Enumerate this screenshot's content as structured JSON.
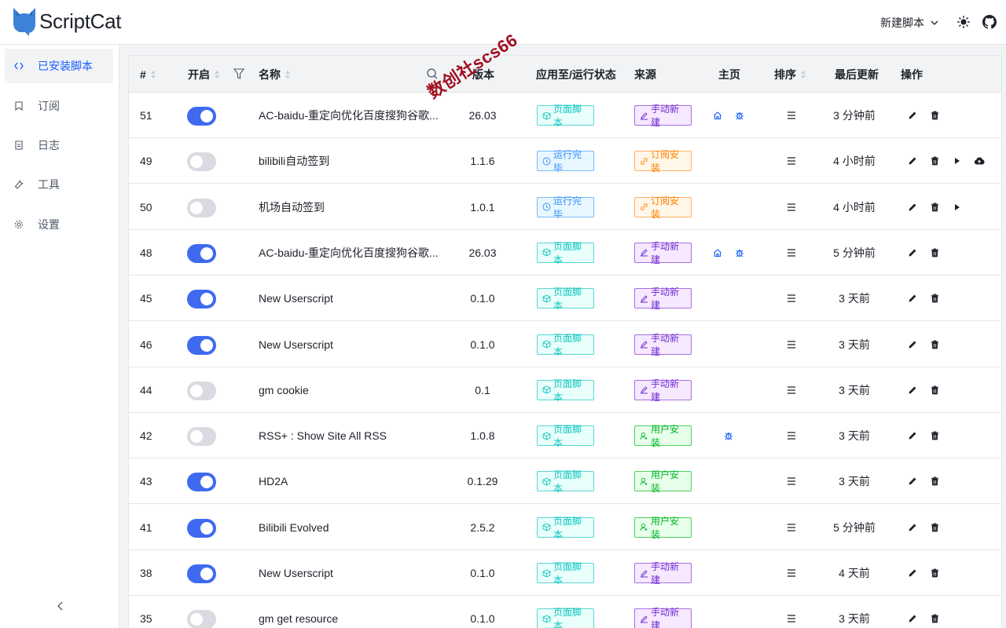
{
  "header": {
    "app_name": "ScriptCat",
    "new_script_label": "新建脚本",
    "icons": [
      "theme-icon",
      "github-icon"
    ]
  },
  "sidebar": {
    "items": [
      {
        "label": "已安装脚本",
        "icon": "code-icon",
        "active": true
      },
      {
        "label": "订阅",
        "icon": "bookmark-icon",
        "active": false
      },
      {
        "label": "日志",
        "icon": "file-icon",
        "active": false
      },
      {
        "label": "工具",
        "icon": "wrench-icon",
        "active": false
      },
      {
        "label": "设置",
        "icon": "gear-icon",
        "active": false
      }
    ]
  },
  "table": {
    "columns": {
      "id": "#",
      "enabled": "开启",
      "name": "名称",
      "version": "版本",
      "apply": "应用至/运行状态",
      "source": "来源",
      "home": "主页",
      "order": "排序",
      "updated": "最后更新",
      "actions": "操作"
    },
    "rows": [
      {
        "id": "51",
        "enabled": true,
        "name": "AC-baidu-重定向优化百度搜狗谷歌...",
        "version": "26.03",
        "status": "页面脚本",
        "status_type": "page",
        "source": "手动新建",
        "source_type": "manual",
        "home": true,
        "bug": true,
        "updated": "3 分钟前",
        "run": false,
        "cloud": false
      },
      {
        "id": "49",
        "enabled": false,
        "name": "bilibili自动签到",
        "version": "1.1.6",
        "status": "运行完毕",
        "status_type": "done",
        "source": "订阅安装",
        "source_type": "sub",
        "home": false,
        "bug": false,
        "updated": "4 小时前",
        "run": true,
        "cloud": true
      },
      {
        "id": "50",
        "enabled": false,
        "name": "机场自动签到",
        "version": "1.0.1",
        "status": "运行完毕",
        "status_type": "done",
        "source": "订阅安装",
        "source_type": "sub",
        "home": false,
        "bug": false,
        "updated": "4 小时前",
        "run": true,
        "cloud": false
      },
      {
        "id": "48",
        "enabled": true,
        "name": "AC-baidu-重定向优化百度搜狗谷歌...",
        "version": "26.03",
        "status": "页面脚本",
        "status_type": "page",
        "source": "手动新建",
        "source_type": "manual",
        "home": true,
        "bug": true,
        "updated": "5 分钟前",
        "run": false,
        "cloud": false
      },
      {
        "id": "45",
        "enabled": true,
        "name": "New Userscript",
        "version": "0.1.0",
        "status": "页面脚本",
        "status_type": "page",
        "source": "手动新建",
        "source_type": "manual",
        "home": false,
        "bug": false,
        "updated": "3 天前",
        "run": false,
        "cloud": false
      },
      {
        "id": "46",
        "enabled": true,
        "name": "New Userscript",
        "version": "0.1.0",
        "status": "页面脚本",
        "status_type": "page",
        "source": "手动新建",
        "source_type": "manual",
        "home": false,
        "bug": false,
        "updated": "3 天前",
        "run": false,
        "cloud": false
      },
      {
        "id": "44",
        "enabled": false,
        "name": "gm cookie",
        "version": "0.1",
        "status": "页面脚本",
        "status_type": "page",
        "source": "手动新建",
        "source_type": "manual",
        "home": false,
        "bug": false,
        "updated": "3 天前",
        "run": false,
        "cloud": false
      },
      {
        "id": "42",
        "enabled": false,
        "name": "RSS+ : Show Site All RSS",
        "version": "1.0.8",
        "status": "页面脚本",
        "status_type": "page",
        "source": "用户安装",
        "source_type": "user",
        "home": false,
        "bug": true,
        "updated": "3 天前",
        "run": false,
        "cloud": false
      },
      {
        "id": "43",
        "enabled": true,
        "name": "HD2A",
        "version": "0.1.29",
        "status": "页面脚本",
        "status_type": "page",
        "source": "用户安装",
        "source_type": "user",
        "home": false,
        "bug": false,
        "updated": "3 天前",
        "run": false,
        "cloud": false
      },
      {
        "id": "41",
        "enabled": true,
        "name": "Bilibili Evolved",
        "version": "2.5.2",
        "status": "页面脚本",
        "status_type": "page",
        "source": "用户安装",
        "source_type": "user",
        "home": false,
        "bug": false,
        "updated": "5 分钟前",
        "run": false,
        "cloud": false
      },
      {
        "id": "38",
        "enabled": true,
        "name": "New Userscript",
        "version": "0.1.0",
        "status": "页面脚本",
        "status_type": "page",
        "source": "手动新建",
        "source_type": "manual",
        "home": false,
        "bug": false,
        "updated": "4 天前",
        "run": false,
        "cloud": false
      },
      {
        "id": "35",
        "enabled": false,
        "name": "gm get resource",
        "version": "0.1.0",
        "status": "页面脚本",
        "status_type": "page",
        "source": "手动新建",
        "source_type": "manual",
        "home": false,
        "bug": false,
        "updated": "3 天前",
        "run": false,
        "cloud": false
      }
    ]
  },
  "watermark": "数创社scs66",
  "colors": {
    "accent": "#165dff",
    "toggle_on": "#3f6af0",
    "toggle_off": "#d9dbe0",
    "page_tag": "#0fc6c2",
    "done_tag": "#3491fa",
    "manual_tag": "#722ed1",
    "sub_tag": "#ff7d00",
    "user_tag": "#00b42a"
  }
}
